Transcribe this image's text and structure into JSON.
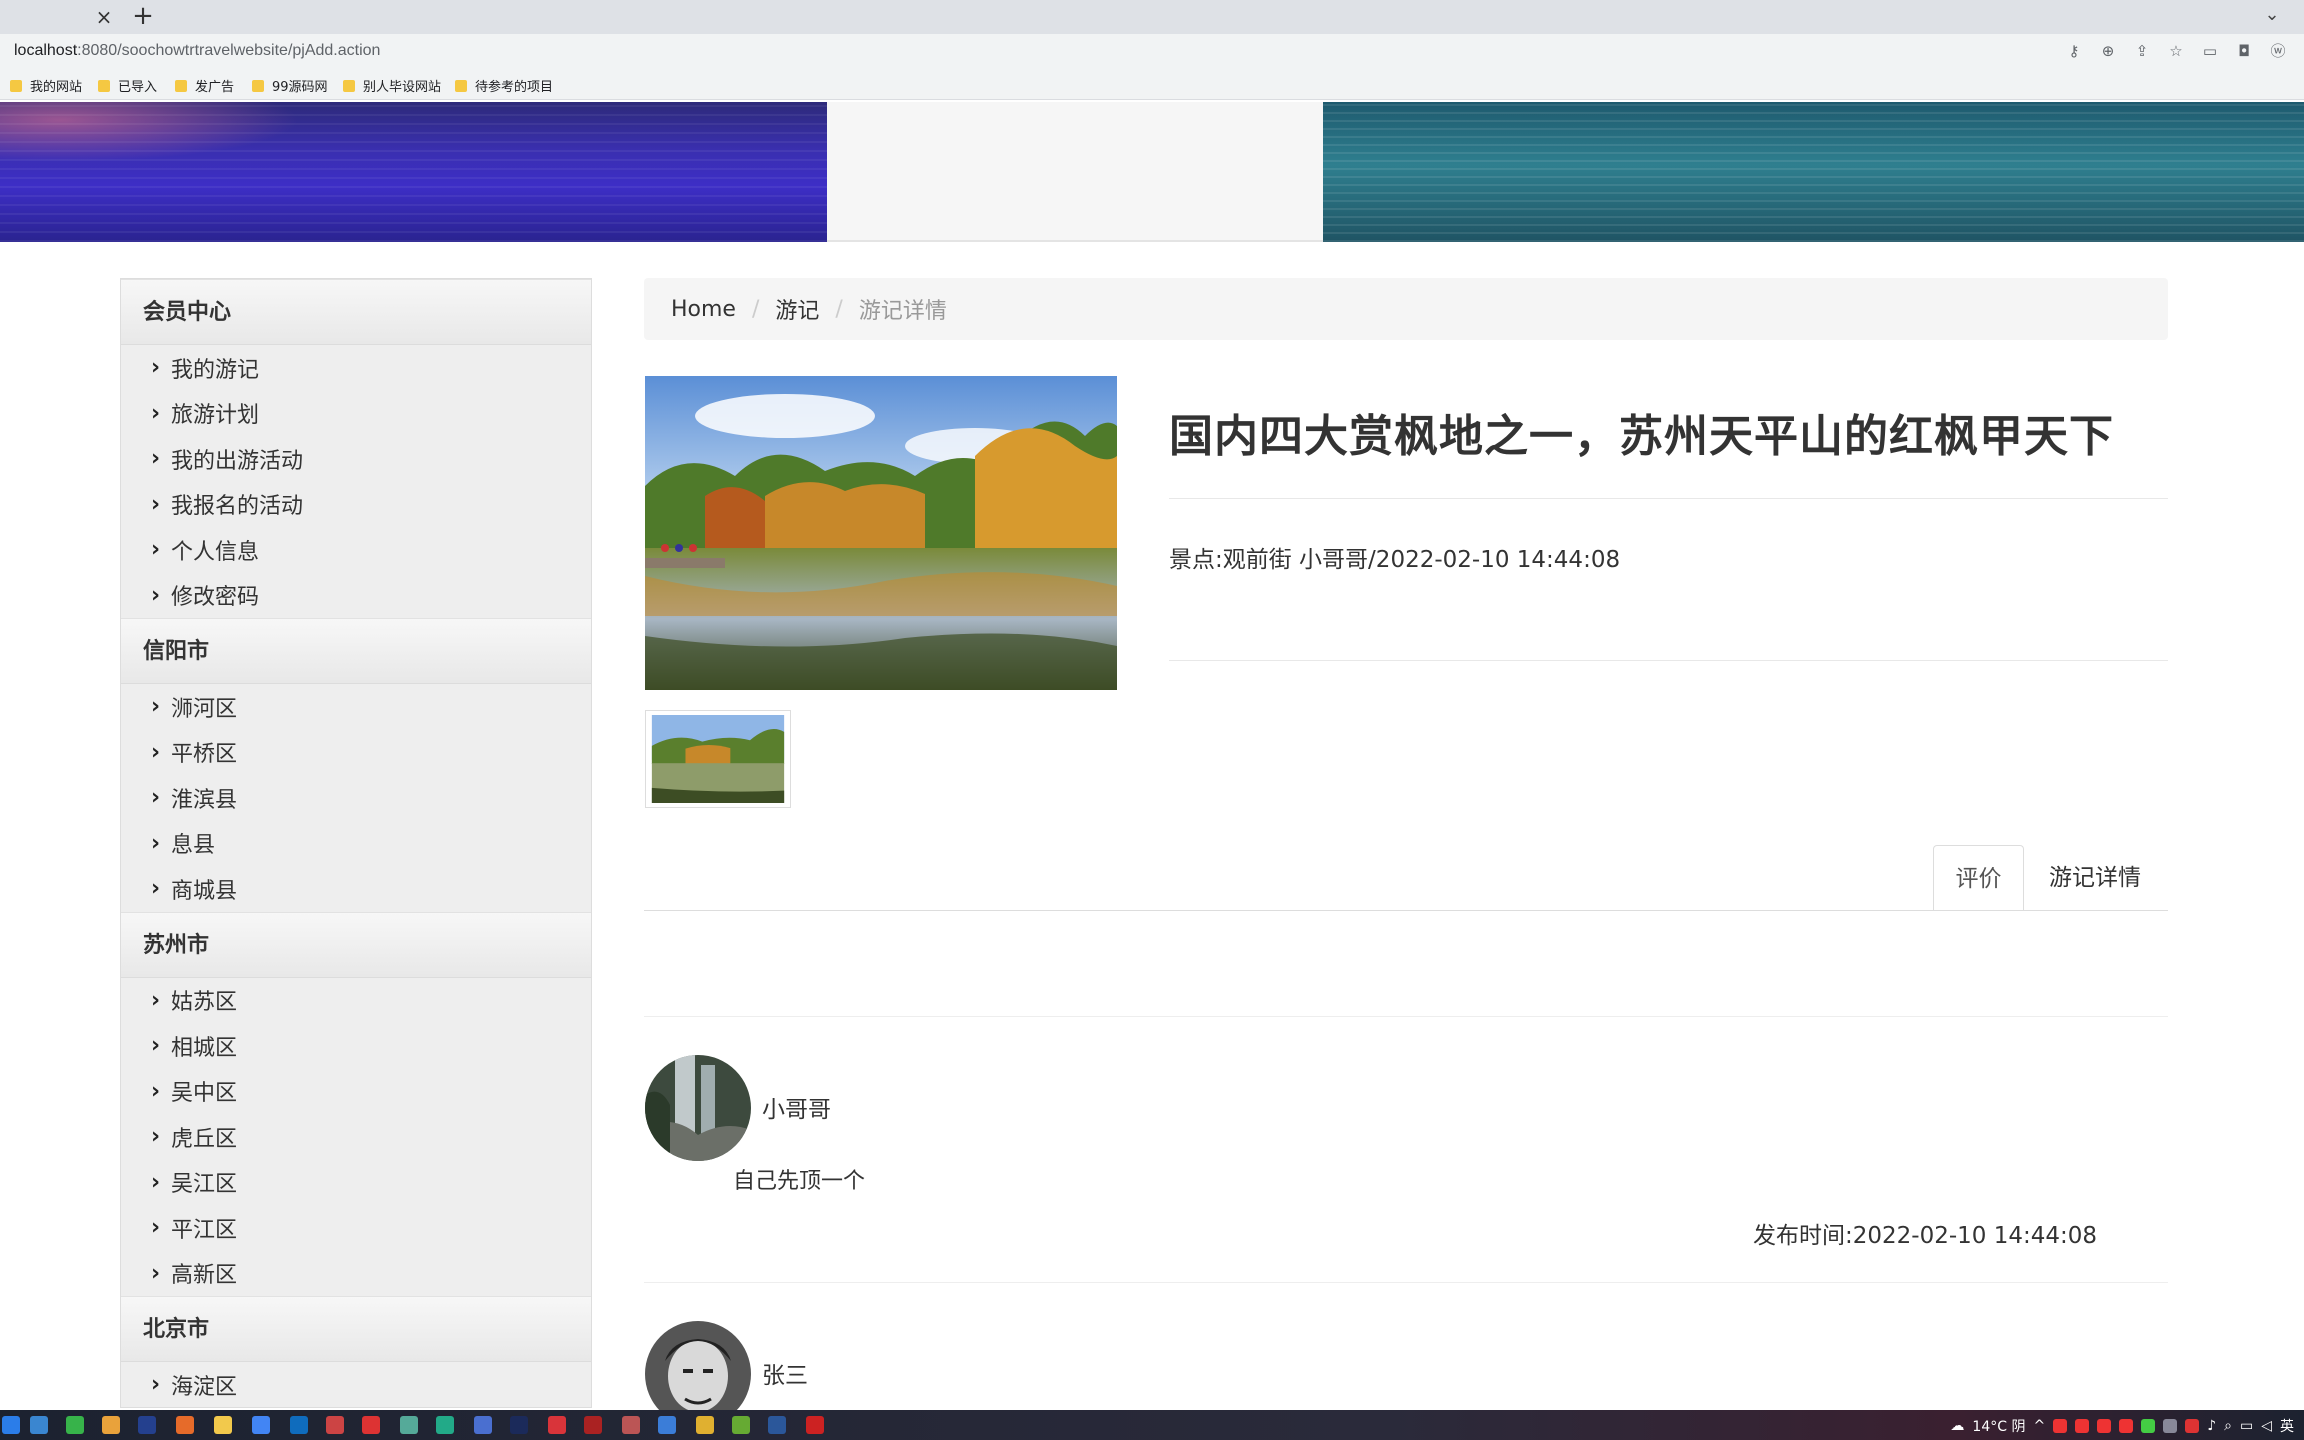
{
  "browser": {
    "url_host": "localhost",
    "url_path": ":8080/soochowtrtravelwebsite/pjAdd.action",
    "bookmarks": [
      "我的网站",
      "已导入",
      "发广告",
      "99源码网",
      "别人毕设网站",
      "待参考的项目"
    ]
  },
  "sidebar": {
    "groups": [
      {
        "title": "会员中心",
        "items": [
          "我的游记",
          "旅游计划",
          "我的出游活动",
          "我报名的活动",
          "个人信息",
          "修改密码"
        ]
      },
      {
        "title": "信阳市",
        "items": [
          "浉河区",
          "平桥区",
          "淮滨县",
          "息县",
          "商城县"
        ]
      },
      {
        "title": "苏州市",
        "items": [
          "姑苏区",
          "相城区",
          "吴中区",
          "虎丘区",
          "吴江区",
          "平江区",
          "高新区"
        ]
      },
      {
        "title": "北京市",
        "items": [
          "海淀区"
        ]
      }
    ]
  },
  "breadcrumb": {
    "home": "Home",
    "section": "游记",
    "current": "游记详情"
  },
  "article": {
    "title": "国内四大赏枫地之一，苏州天平山的红枫甲天下",
    "meta": "景点:观前街 小哥哥/2022-02-10 14:44:08"
  },
  "tabs": {
    "review": "评价",
    "detail": "游记详情"
  },
  "comments": [
    {
      "name": "小哥哥",
      "text": "自己先顶一个",
      "time": "发布时间:2022-02-10 14:44:08"
    },
    {
      "name": "张三"
    }
  ],
  "taskbar": {
    "weather": "14°C 阴",
    "ime": "英"
  }
}
